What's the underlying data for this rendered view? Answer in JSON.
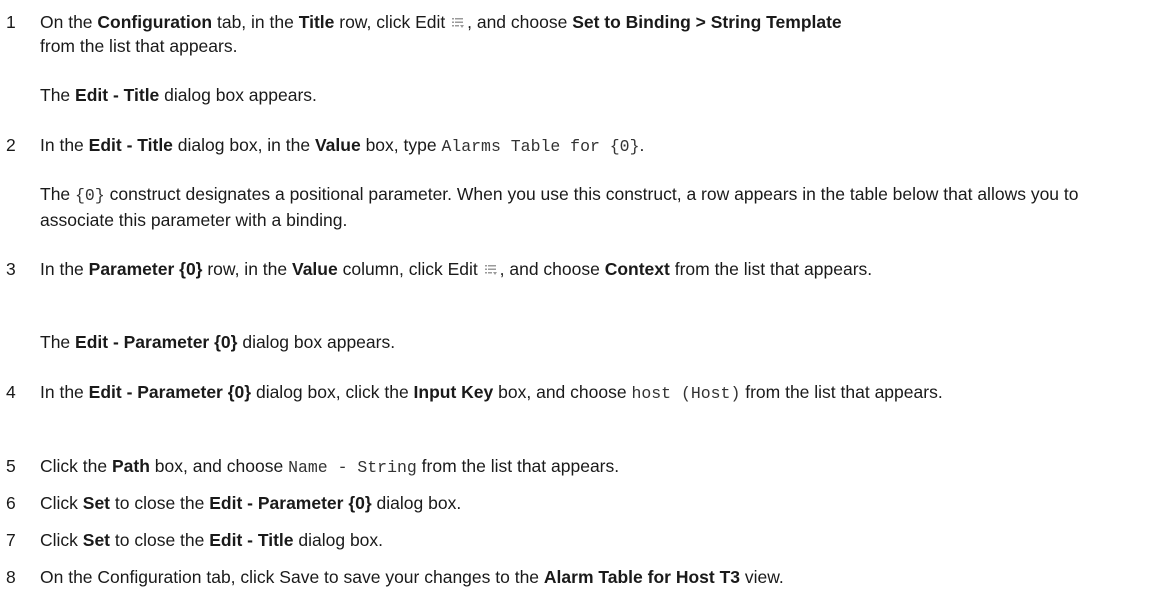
{
  "steps": [
    {
      "number": "1",
      "parts": [
        "On the ",
        "Configuration",
        " tab, in the ",
        "Title",
        " row, click Edit ",
        ", and choose ",
        "Set to Binding > String Template",
        " from the list that appears."
      ],
      "icon": "edit-list-icon"
    },
    {
      "number": "2",
      "parts": [
        "In the ",
        "Edit - Title",
        " dialog box, in the ",
        "Value",
        " box, type ",
        "Alarms Table for {0}",
        "."
      ]
    },
    {
      "number": "3",
      "parts": [
        "In the ",
        "Parameter {0}",
        " row, in the ",
        "Value",
        " column, click Edit ",
        ", and choose ",
        "Context",
        " from the list that appears."
      ],
      "icon": "edit-list-icon"
    },
    {
      "number": "4",
      "parts": [
        "In the ",
        "Edit - Parameter {0}",
        " dialog box, click the ",
        "Input Key",
        " box, and choose ",
        "host (Host)",
        " from the list that appears."
      ]
    },
    {
      "number": "5",
      "parts": [
        "Click the ",
        "Path",
        " box, and choose ",
        "Name - String",
        " from the list that appears."
      ]
    },
    {
      "number": "6",
      "parts": [
        "Click ",
        "Set",
        " to close the ",
        "Edit - Parameter {0}",
        " dialog box."
      ]
    },
    {
      "number": "7",
      "parts": [
        "Click ",
        "Set",
        " to close the ",
        "Edit - Title",
        " dialog box."
      ]
    },
    {
      "number": "8",
      "parts": [
        "On the Configuration tab, click Save to save your changes to the ",
        "Alarm Table for Host T3",
        " view."
      ]
    }
  ],
  "notes": {
    "note1": [
      "The ",
      "Edit - Title",
      " dialog box appears."
    ],
    "note2": [
      "The ",
      "{0}",
      " construct designates a positional parameter. When you use this construct, a row appears in the table below that allows you to associate this parameter with a binding."
    ],
    "note3": [
      "The ",
      "Edit - Parameter {0}",
      " dialog box appears."
    ]
  },
  "icon_color": "#9a9a9a"
}
